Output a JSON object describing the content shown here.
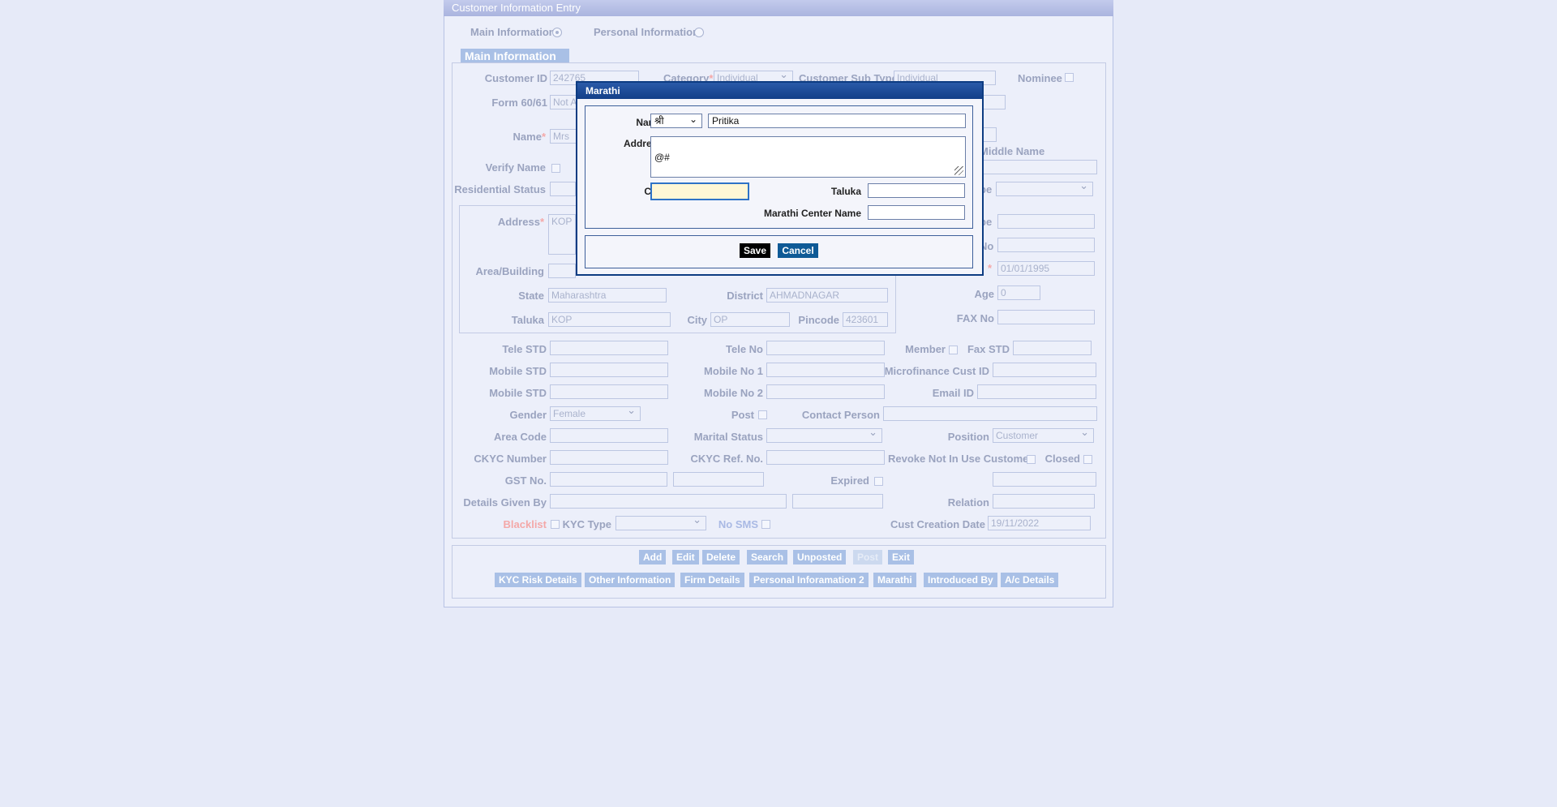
{
  "window": {
    "title": "Customer Information Entry"
  },
  "radios": {
    "main": "Main Information",
    "personal": "Personal Information"
  },
  "section": {
    "title": "Main Information"
  },
  "form": {
    "customer_id_label": "Customer ID",
    "customer_id": "242765",
    "category_label": "Category",
    "category": "Individual",
    "sub_type_label": "Customer Sub Type",
    "sub_type": "Individual",
    "nominee_label": "Nominee",
    "form60_label": "Form 60/61",
    "form60": "Not A",
    "name_label": "Name",
    "name_title": "Mrs",
    "middle_name_label": "Middle Name",
    "verify_name_label": "Verify Name",
    "residential_status_label": "Residential Status",
    "address_label": "Address",
    "address": "KOP",
    "area_label": "Area/Building",
    "state_label": "State",
    "state": "Maharashtra",
    "district_label": "District",
    "district": "AHMADNAGAR",
    "taluka_label": "Taluka",
    "taluka": "KOP",
    "city_label": "City",
    "city": "OP",
    "pincode_label": "Pincode",
    "pincode": "423601",
    "type_label_fragment": "pe",
    "no_label_fragment": "No",
    "dob_value": "01/01/1995",
    "age_label": "Age",
    "age": "0",
    "fax_no_label": "FAX No",
    "tele_std_label": "Tele STD",
    "tele_no_label": "Tele No",
    "member_label": "Member",
    "fax_std_label": "Fax STD",
    "mobile_std_label": "Mobile STD",
    "mobile_no1_label": "Mobile No 1",
    "microfinance_label": "Microfinance Cust ID",
    "mobile_std2_label": "Mobile STD",
    "mobile_no2_label": "Mobile No 2",
    "email_label": "Email ID",
    "gender_label": "Gender",
    "gender": "Female",
    "post_label": "Post",
    "contact_person_label": "Contact Person",
    "area_code_label": "Area Code",
    "marital_label": "Marital Status",
    "position_label": "Position",
    "position": "Customer",
    "ckyc_number_label": "CKYC Number",
    "ckyc_ref_label": "CKYC Ref. No.",
    "revoke_label": "Revoke Not In Use Customer",
    "closed_label": "Closed",
    "gst_label": "GST No.",
    "expired_label": "Expired",
    "details_given_label": "Details Given By",
    "relation_label": "Relation",
    "blacklist_label": "Blacklist",
    "kyc_type_label": "KYC Type",
    "no_sms_label": "No SMS",
    "cust_creation_label": "Cust Creation Date",
    "cust_creation": "19/11/2022"
  },
  "buttons_row1": [
    "Add",
    "Edit",
    "Delete",
    "Search",
    "Unposted",
    "Post",
    "Exit"
  ],
  "buttons_row2": [
    "KYC Risk Details",
    "Other Information",
    "Firm Details",
    "Personal Inforamation 2",
    "Marathi",
    "Introduced By",
    "A/c Details"
  ],
  "modal": {
    "title": "Marathi",
    "name_label": "Name",
    "name_prefix": "श्री",
    "name_value": "Pritika",
    "address_label": "Address",
    "address_value": "@#",
    "city_label": "City",
    "city_value": "",
    "taluka_label": "Taluka",
    "taluka_value": "",
    "center_label": "Marathi Center Name",
    "center_value": "",
    "save_label": "Save",
    "cancel_label": "Cancel"
  },
  "colors": {
    "modal_border": "#0d3c82",
    "save_button": "#000000",
    "cancel_button": "#0f5a96",
    "focus_field": "#fff7d6"
  }
}
